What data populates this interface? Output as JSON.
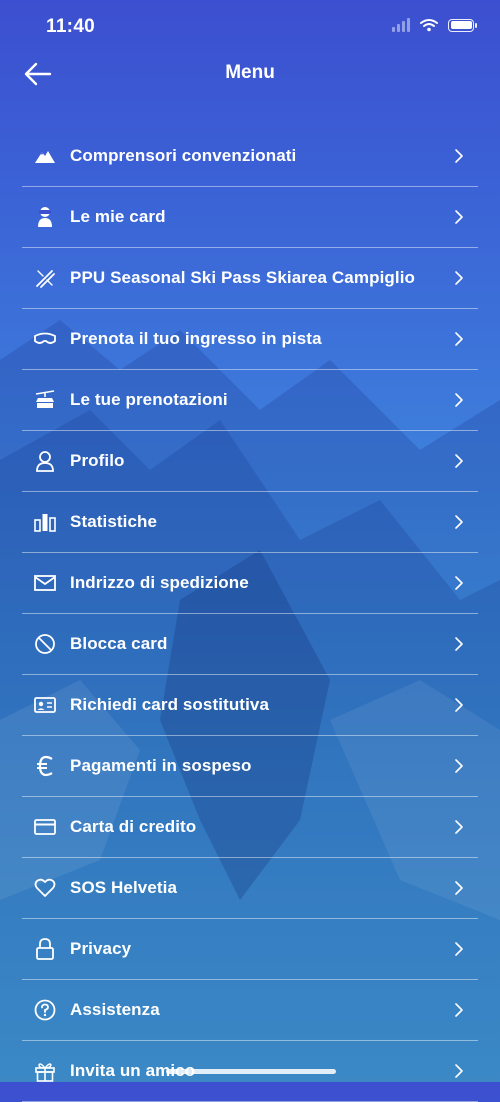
{
  "status_bar": {
    "time": "11:40"
  },
  "header": {
    "title": "Menu"
  },
  "menu": {
    "items": [
      {
        "label": "Comprensori convenzionati",
        "icon": "mountain-icon"
      },
      {
        "label": "Le mie card",
        "icon": "skier-icon"
      },
      {
        "label": "PPU Seasonal Ski Pass Skiarea Campiglio",
        "icon": "skis-icon"
      },
      {
        "label": "Prenota il tuo ingresso in pista",
        "icon": "goggles-icon"
      },
      {
        "label": "Le tue prenotazioni",
        "icon": "cable-car-icon"
      },
      {
        "label": "Profilo",
        "icon": "user-icon"
      },
      {
        "label": "Statistiche",
        "icon": "bar-chart-icon"
      },
      {
        "label": "Indrizzo di spedizione",
        "icon": "envelope-icon"
      },
      {
        "label": "Blocca card",
        "icon": "block-icon"
      },
      {
        "label": "Richiedi card sostitutiva",
        "icon": "id-card-icon"
      },
      {
        "label": "Pagamenti in sospeso",
        "icon": "euro-icon"
      },
      {
        "label": "Carta di credito",
        "icon": "credit-card-icon"
      },
      {
        "label": "SOS Helvetia",
        "icon": "heart-icon"
      },
      {
        "label": "Privacy",
        "icon": "lock-icon"
      },
      {
        "label": "Assistenza",
        "icon": "help-icon"
      },
      {
        "label": "Invita un amico",
        "icon": "gift-icon"
      }
    ]
  },
  "colors": {
    "gradient_top": "#3c4fd0",
    "gradient_bottom": "#58c8f2",
    "text": "#ffffff"
  }
}
